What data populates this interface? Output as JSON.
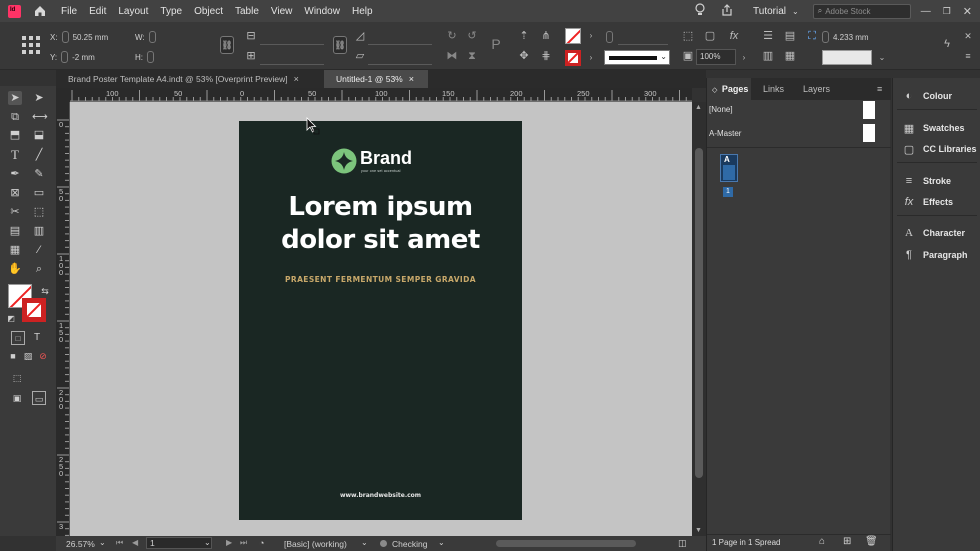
{
  "menubar": {
    "items": [
      "File",
      "Edit",
      "Layout",
      "Type",
      "Object",
      "Table",
      "View",
      "Window",
      "Help"
    ],
    "workspace": "Tutorial",
    "search_placeholder": "Adobe Stock"
  },
  "controlbar": {
    "x_label": "X:",
    "x_value": "50.25 mm",
    "y_label": "Y:",
    "y_value": "-2 mm",
    "w_label": "W:",
    "h_label": "H:",
    "zoom_value": "100%",
    "stroke_weight": "4.233 mm"
  },
  "tabs": [
    {
      "label": "Brand Poster Template A4.indt @ 53% [Overprint Preview]",
      "close": "×"
    },
    {
      "label": "Untitled-1 @ 53%",
      "close": "×"
    }
  ],
  "ruler": {
    "h_ticks": [
      "100",
      "50",
      "0",
      "50",
      "100",
      "150",
      "200",
      "250",
      "300"
    ],
    "v_ticks": [
      "0",
      "5\n0",
      "1\n0\n0",
      "1\n5\n0",
      "2\n0\n0",
      "2\n5\n0",
      "3"
    ]
  },
  "poster": {
    "brand": "Brand",
    "brand_tagline": "your one set accentual",
    "headline_line1": "Lorem ipsum",
    "headline_line2": "dolor sit amet",
    "subheading": "PRAESENT FERMENTUM SEMPER GRAVIDA",
    "website": "www.brandwebsite.com",
    "bg_color": "#1a2723",
    "accent_color": "#7cc47c",
    "sub_color": "#c8a86a"
  },
  "statusbar": {
    "zoom": "26.57%",
    "page": "1",
    "style": "[Basic] (working)",
    "preflight": "Checking"
  },
  "pages_panel": {
    "tabs": [
      "Pages",
      "Links",
      "Layers"
    ],
    "masters": [
      "[None]",
      "A-Master"
    ],
    "page_master_letter": "A",
    "page_number": "1",
    "footer": "1 Page in 1 Spread"
  },
  "right_panels": [
    "Colour",
    "Swatches",
    "CC Libraries",
    "Stroke",
    "Effects",
    "Character",
    "Paragraph"
  ]
}
